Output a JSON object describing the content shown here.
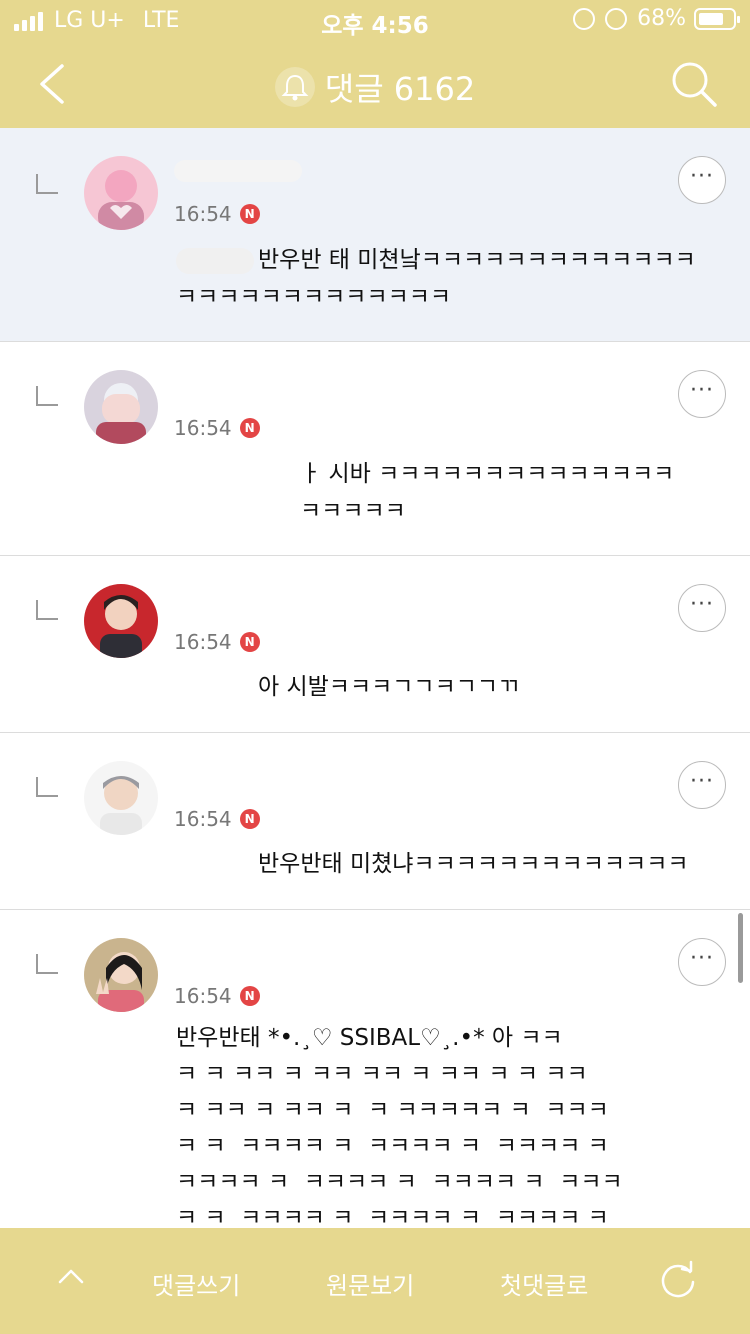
{
  "status_bar": {
    "carrier": "LG U+",
    "network": "LTE",
    "time": "오후 4:56",
    "battery": "68%",
    "battery_level": 0.68
  },
  "header": {
    "title": "댓글 6162",
    "back_icon": "chevron-left-icon",
    "search_icon": "search-icon",
    "bell_icon": "bell-icon",
    "background": "#e6d88f"
  },
  "comments": [
    {
      "time": "16:54",
      "badge": "N",
      "text": "반우반 태 미쳔낰ㅋㅋㅋㅋㅋㅋㅋㅋㅋㅋㅋㅋㅋㅋㅋㅋㅋㅋㅋㅋㅋㅋㅋㅋㅋㅋ",
      "more": "···"
    },
    {
      "time": "16:54",
      "badge": "N",
      "text": "ㅏ 시바 ㅋㅋㅋㅋㅋㅋㅋㅋㅋㅋㅋㅋㅋㅋ\nㅋㅋㅋㅋㅋ",
      "more": "···"
    },
    {
      "time": "16:54",
      "badge": "N",
      "text": "아 시발ㅋㅋㅋㄱㄱㅋㄱㄱㄲ",
      "more": "···"
    },
    {
      "time": "16:54",
      "badge": "N",
      "text": "반우반태 미쳤냐ㅋㅋㅋㅋㅋㅋㅋㅋㅋㅋㅋㅋㅋ",
      "more": "···"
    },
    {
      "time": "16:54",
      "badge": "N",
      "text": "반우반태 *•.¸♡ SSIBAL♡¸.•* 아 ㅋㅋ\nㅋ ㅋ ㅋㅋ ㅋ ㅋㅋ ㅋㅋ ㅋ ㅋㅋ ㅋ ㅋ ㅋㅋ\nㅋ ㅋㅋ ㅋ ㅋㅋ ㅋ  ㅋ ㅋㅋㅋㅋㅋ ㅋ  ㅋㅋㅋ\nㅋ ㅋ  ㅋㅋㅋㅋ ㅋ  ㅋㅋㅋㅋ ㅋ  ㅋㅋㅋㅋ ㅋ\nㅋㅋㅋㅋ ㅋ  ㅋㅋㅋㅋ ㅋ  ㅋㅋㅋㅋ ㅋ  ㅋㅋㅋ\nㅋ ㅋ  ㅋㅋㅋㅋ ㅋ  ㅋㅋㅋㅋ ㅋ  ㅋㅋㅋㅋ ㅋ",
      "more": "···"
    }
  ],
  "bottom_bar": {
    "up_icon": "chevron-up-icon",
    "write": "댓글쓰기",
    "view_original": "원문보기",
    "first_comment": "첫댓글로",
    "refresh_icon": "refresh-icon"
  }
}
